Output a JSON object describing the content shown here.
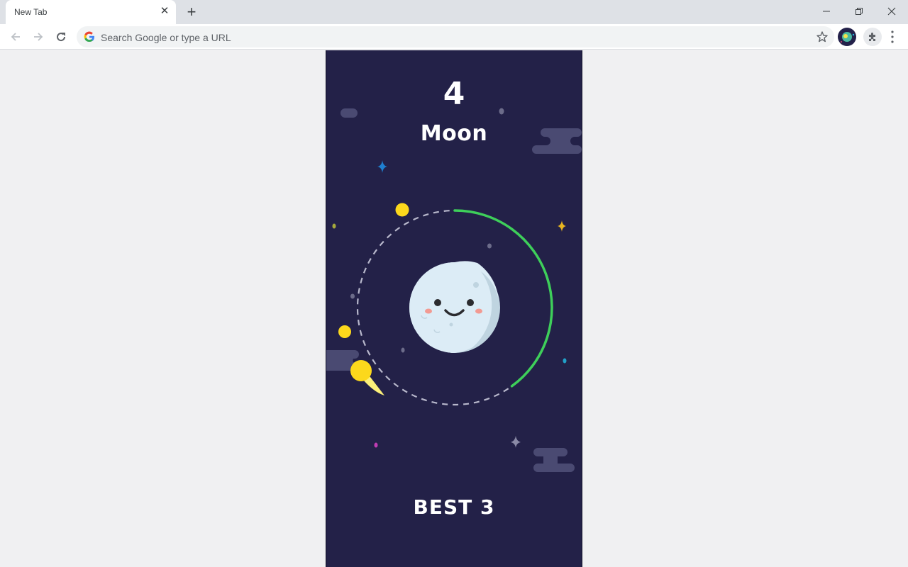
{
  "browser": {
    "tab_title": "New Tab",
    "tab_close_icon": "close-icon",
    "new_tab_icon": "plus-icon",
    "omnibox_placeholder": "Search Google or type a URL",
    "window_controls": [
      "minimize-icon",
      "restore-icon",
      "close-icon"
    ],
    "nav": [
      "back-arrow-icon",
      "forward-arrow-icon",
      "reload-icon"
    ]
  },
  "game": {
    "score": "4",
    "level_name": "Moon",
    "best_label": "BEST 3",
    "colors": {
      "background": "#232148",
      "orbit_progress": "#3ecf5a",
      "orbit_dashes": "#b8b8cc",
      "coin": "#fcd81c",
      "planet": "#dcecf6",
      "planet_shade": "#bfd4e0",
      "cloud": "#4a4a72"
    },
    "orbit_progress_fraction": 0.4
  }
}
